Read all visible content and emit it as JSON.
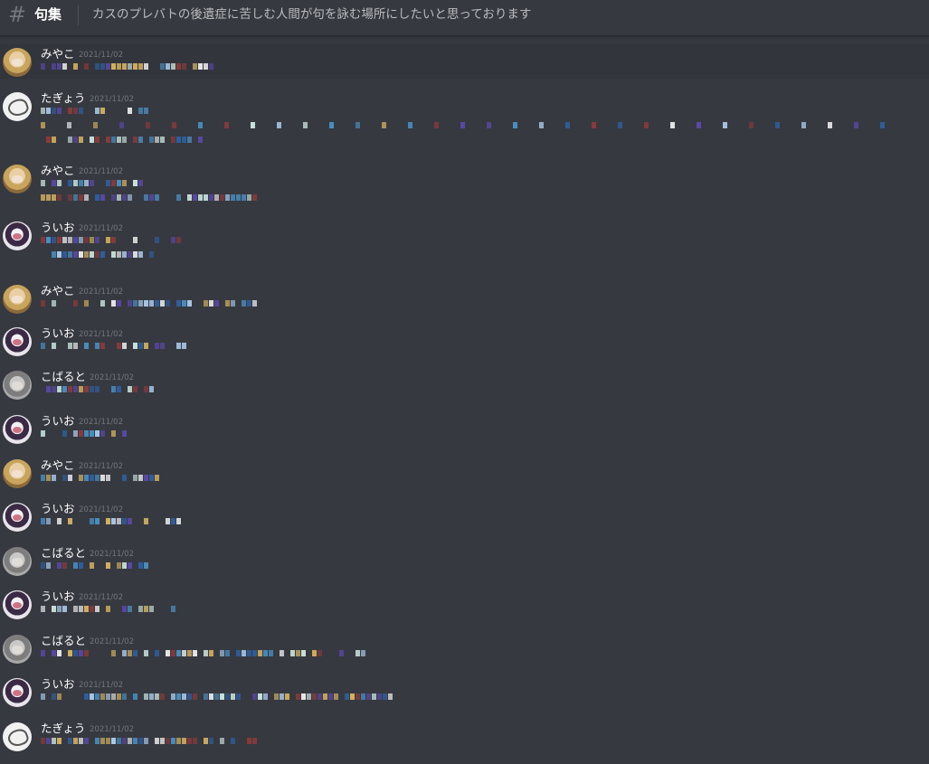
{
  "channel": {
    "hash_glyph": "#",
    "name": "句集",
    "topic": "カスのプレバトの後遺症に苦しむ人間が句を詠む場所にしたいと思っております"
  },
  "messages": [
    {
      "author": "みやこ",
      "timestamp": "2021/11/02",
      "avatar": "miyako-avatar"
    },
    {
      "author": "たぎょう",
      "timestamp": "2021/11/02",
      "avatar": "tagyou-avatar"
    },
    {
      "author": "みやこ",
      "timestamp": "2021/11/02",
      "avatar": "miyako-avatar"
    },
    {
      "author": "ういお",
      "timestamp": "2021/11/02",
      "avatar": "uio-avatar"
    },
    {
      "author": "みやこ",
      "timestamp": "2021/11/02",
      "avatar": "miyako-avatar"
    },
    {
      "author": "ういお",
      "timestamp": "2021/11/02",
      "avatar": "uio-avatar"
    },
    {
      "author": "こばると",
      "timestamp": "2021/11/02",
      "avatar": "koharuto-avatar"
    },
    {
      "author": "ういお",
      "timestamp": "2021/11/02",
      "avatar": "uio-avatar"
    },
    {
      "author": "みやこ",
      "timestamp": "2021/11/02",
      "avatar": "miyako-avatar"
    },
    {
      "author": "ういお",
      "timestamp": "2021/11/02",
      "avatar": "uio-avatar"
    },
    {
      "author": "こばると",
      "timestamp": "2021/11/02",
      "avatar": "koharuto-avatar"
    },
    {
      "author": "ういお",
      "timestamp": "2021/11/02",
      "avatar": "uio-avatar"
    },
    {
      "author": "こばると",
      "timestamp": "2021/11/02",
      "avatar": "koharuto-avatar"
    },
    {
      "author": "ういお",
      "timestamp": "2021/11/02",
      "avatar": "uio-avatar"
    },
    {
      "author": "たぎょう",
      "timestamp": "2021/11/02",
      "avatar": "tagyou-avatar"
    }
  ],
  "colors": {
    "background": "#36393f",
    "highlight": "#32353b",
    "username": "#ffffff",
    "timestamp": "#72767d",
    "topic": "#b9bbbe",
    "blur_palette": [
      "#4a90c4",
      "#d4b060",
      "#c9e2da",
      "#8b3a3a",
      "#5a48a8",
      "#a9c8e8",
      "#e6e6e6",
      "#2f5fa0"
    ]
  }
}
